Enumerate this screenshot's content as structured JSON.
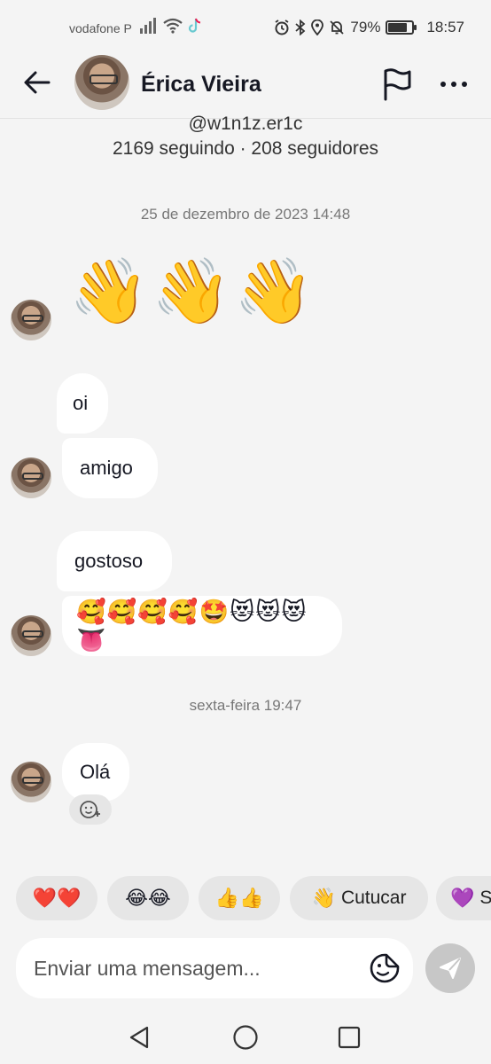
{
  "status_bar": {
    "carrier": "vodafone P",
    "battery_percent": "79%",
    "battery_level": 0.79,
    "time": "18:57"
  },
  "header": {
    "name": "Érica Vieira",
    "icons": [
      "back-arrow-icon",
      "flag-icon",
      "more-icon"
    ]
  },
  "profile": {
    "handle": "@w1n1z.er1c",
    "follow_stats": "2169 seguindo · 208 seguidores"
  },
  "timestamps": {
    "first": "25 de dezembro de 2023 14:48",
    "second": "sexta-feira 19:47"
  },
  "messages": [
    {
      "text": "👋",
      "type": "big-emoji"
    },
    {
      "text": "👋",
      "type": "big-emoji"
    },
    {
      "text": "👋",
      "type": "big-emoji"
    },
    {
      "text": "oi",
      "type": "bubble"
    },
    {
      "text": "amigo",
      "type": "bubble"
    },
    {
      "text": "gostoso",
      "type": "bubble"
    },
    {
      "text": "🥰🥰🥰🥰🤩😻😻😻👅",
      "type": "bubble-emoji"
    },
    {
      "text": "Olá",
      "type": "bubble"
    }
  ],
  "quick_replies": [
    {
      "emoji": "❤️❤️",
      "label": ""
    },
    {
      "emoji": "😂😂",
      "label": ""
    },
    {
      "emoji": "👍👍",
      "label": ""
    },
    {
      "emoji": "👋",
      "label": "Cutucar"
    },
    {
      "emoji": "💜",
      "label": "S"
    }
  ],
  "composer": {
    "placeholder": "Enviar uma mensagem..."
  },
  "colors": {
    "background": "#f4f4f4",
    "bubble": "#ffffff",
    "chip": "#e6e6e6",
    "send_disabled": "#c7c7c7"
  }
}
